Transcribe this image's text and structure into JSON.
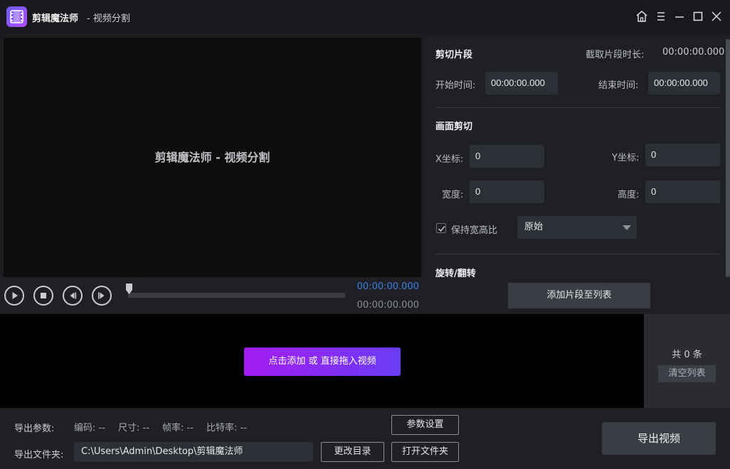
{
  "title_bar": {
    "app_name": "剪辑魔法师",
    "subtitle": "- 视频分割",
    "icons": [
      "home-icon",
      "menu-icon",
      "minimize-icon",
      "maximize-icon",
      "close-icon"
    ]
  },
  "preview": {
    "title": "剪辑魔法师 - 视频分割",
    "current_time": "00:00:00.000",
    "total_time": "00:00:00.000",
    "progress": 0,
    "controls": [
      "play-icon",
      "stop-icon",
      "previous-frame-icon",
      "next-frame-icon"
    ]
  },
  "cut_segment": {
    "title": "剪切片段",
    "duration_label": "截取片段时长:",
    "duration_value": "00:00:00.000",
    "start_label": "开始时间:",
    "start_value": "00:00:00.000",
    "end_label": "结束时间:",
    "end_value": "00:00:00.000"
  },
  "crop": {
    "title": "画面剪切",
    "x_label": "X坐标:",
    "x_value": "0",
    "y_label": "Y坐标:",
    "y_value": "0",
    "width_label": "宽度:",
    "width_value": "0",
    "height_label": "高度:",
    "height_value": "0",
    "keep_ratio_label": "保持宽高比",
    "keep_ratio_checked": true,
    "ratio_selected": "原始"
  },
  "rotate": {
    "title": "旋转/翻转"
  },
  "add_segment_button": "添加片段至列表",
  "list": {
    "add_video_button": "点击添加 或 直接拖入视频",
    "count_text": "共 0 条",
    "clear_button": "清空列表"
  },
  "export": {
    "params_label": "导出参数:",
    "codec": "编码: --",
    "size": "尺寸: --",
    "fps": "帧率: --",
    "bitrate": "比特率: --",
    "settings_button": "参数设置",
    "folder_label": "导出文件夹:",
    "folder_path": "C:\\Users\\Admin\\Desktop\\剪辑魔法师",
    "change_dir_button": "更改目录",
    "open_folder_button": "打开文件夹",
    "export_button": "导出视频"
  },
  "colors": {
    "accent_blue": "#3d7fe0",
    "gradient_start": "#a41cf3",
    "gradient_end": "#6a3cf5"
  }
}
